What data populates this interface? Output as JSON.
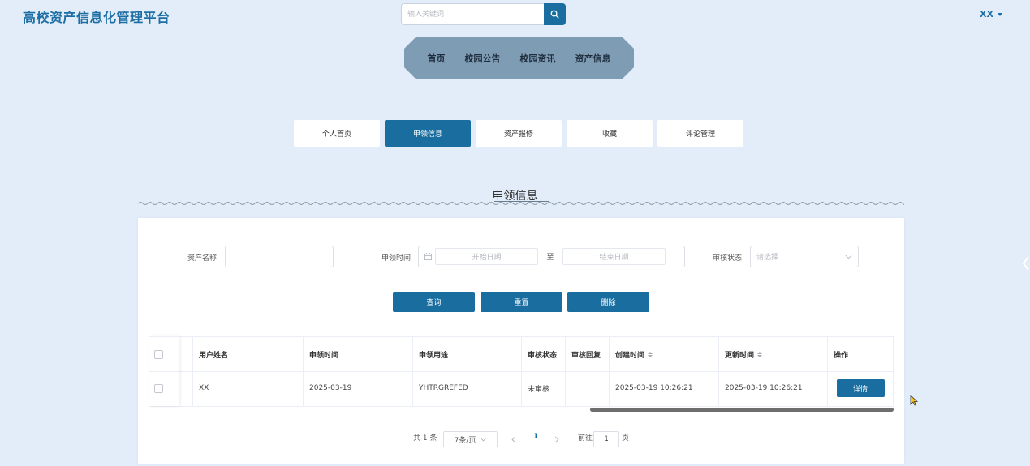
{
  "header": {
    "site_title": "高校资产信息化管理平台",
    "search_placeholder": "输入关键词",
    "user_name": "XX"
  },
  "nav": {
    "items": [
      {
        "label": "首页"
      },
      {
        "label": "校园公告"
      },
      {
        "label": "校园资讯"
      },
      {
        "label": "资产信息"
      }
    ]
  },
  "tabs": [
    {
      "label": "个人首页",
      "active": false
    },
    {
      "label": "申领信息",
      "active": true
    },
    {
      "label": "资产报修",
      "active": false
    },
    {
      "label": "收藏",
      "active": false
    },
    {
      "label": "评论管理",
      "active": false
    }
  ],
  "section": {
    "title": "申领信息"
  },
  "filters": {
    "asset_name_label": "资产名称",
    "asset_name_value": "",
    "apply_time_label": "申领时间",
    "start_placeholder": "开始日期",
    "range_separator": "至",
    "end_placeholder": "结束日期",
    "review_status_label": "审核状态",
    "review_status_placeholder": "请选择"
  },
  "actions": {
    "query": "查询",
    "reset": "重置",
    "delete": "删除"
  },
  "table": {
    "columns": [
      "用户姓名",
      "申领时间",
      "申领用途",
      "审核状态",
      "审核回复",
      "创建时间",
      "更新时间",
      "操作"
    ],
    "rows": [
      {
        "user_name": "XX",
        "apply_time": "2025-03-19",
        "purpose": "YHTRGREFED",
        "review_status": "未审核",
        "review_reply": "",
        "created_at": "2025-03-19 10:26:21",
        "updated_at": "2025-03-19 10:26:21",
        "action_label": "详情"
      }
    ]
  },
  "pagination": {
    "total_text": "共 1 条",
    "page_size": "7条/页",
    "current_page": "1",
    "goto_label": "前往",
    "goto_value": "1",
    "page_suffix": "页"
  },
  "colors": {
    "primary": "#1a6e9f",
    "background": "#e3edf9",
    "nav_bg": "#7f9cb5",
    "title": "#1c6ea4"
  },
  "icons": {
    "search": "magnifier",
    "calendar": "calendar",
    "select": "chevron-down",
    "sort": "sort-caret"
  }
}
